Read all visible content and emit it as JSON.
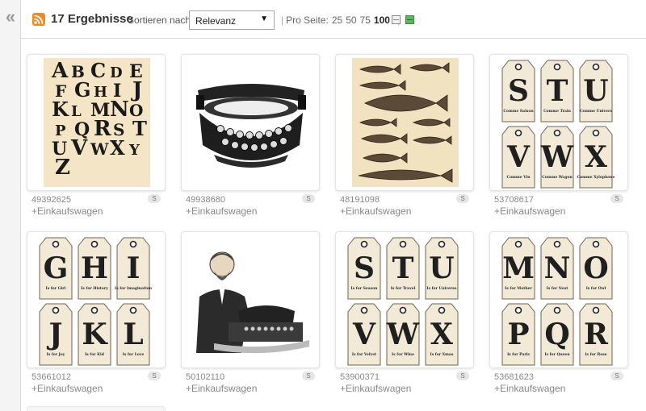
{
  "sidebar": {
    "collapse_glyph": "«",
    "collapse_icon": "double-chevron-left-icon"
  },
  "toolbar": {
    "feed_icon": "rss-icon",
    "result_count": "17 Ergebnisse",
    "sort_label": "Sortieren nach",
    "sort_value": "Relevanz",
    "per_page_label": "Pro Seite:",
    "per_page_options": [
      "25",
      "50",
      "75",
      "100"
    ],
    "per_page_selected": "100",
    "view_grid_icon": "grid-view-icon",
    "view_list_icon": "list-view-icon"
  },
  "colors": {
    "rss": "#f08a24",
    "active_view": "#5cb85c",
    "link": "#888888"
  },
  "results": [
    {
      "id": "49392625",
      "badge": "S",
      "cart": "+Einkaufswagen",
      "subject": "vintage-alphabet-letters"
    },
    {
      "id": "49938680",
      "badge": "S",
      "cart": "+Einkaufswagen",
      "subject": "vintage-typewriter"
    },
    {
      "id": "48191098",
      "badge": "S",
      "cart": "+Einkaufswagen",
      "subject": "vintage-fish-chart"
    },
    {
      "id": "53708617",
      "badge": "S",
      "cart": "+Einkaufswagen",
      "subject": "letter-tags-stuvwx"
    },
    {
      "id": "53661012",
      "badge": "S",
      "cart": "+Einkaufswagen",
      "subject": "letter-tags-ghijkl"
    },
    {
      "id": "50102110",
      "badge": "S",
      "cart": "+Einkaufswagen",
      "subject": "man-with-typewriter"
    },
    {
      "id": "53900371",
      "badge": "S",
      "cart": "+Einkaufswagen",
      "subject": "letter-tags-stuvwx-english"
    },
    {
      "id": "53681623",
      "badge": "S",
      "cart": "+Einkaufswagen",
      "subject": "letter-tags-mnopqr"
    }
  ],
  "tags": {
    "t4": {
      "letters": [
        "S",
        "T",
        "U",
        "V",
        "W",
        "X"
      ],
      "captions": [
        "Comme Saison",
        "Comme Train",
        "Comme Univers",
        "Comme Vin",
        "Comme Wagon",
        "Comme Xylophone"
      ]
    },
    "t5": {
      "letters": [
        "G",
        "H",
        "I",
        "J",
        "K",
        "L"
      ],
      "captions": [
        "Is for Girl",
        "Is for History",
        "Is for Imagination",
        "Is for Joy",
        "Is for Kid",
        "Is for Love"
      ]
    },
    "t7": {
      "letters": [
        "S",
        "T",
        "U",
        "V",
        "W",
        "X"
      ],
      "captions": [
        "Is for Season",
        "Is for Travel",
        "Is for Universe",
        "Is for Velvet",
        "Is for Wine",
        "Is for Xmas"
      ]
    },
    "t8": {
      "letters": [
        "M",
        "N",
        "O",
        "P",
        "Q",
        "R"
      ],
      "captions": [
        "Is for Mother",
        "Is for Nest",
        "Is for Owl",
        "Is for Paris",
        "Is for Queen",
        "Is for Rose"
      ]
    }
  },
  "alphabet_art": [
    "A",
    "B",
    "C",
    "D",
    "E",
    "F",
    "G",
    "H",
    "I",
    "J",
    "K",
    "L",
    "M",
    "N",
    "O",
    "P",
    "Q",
    "R",
    "S",
    "T",
    "U",
    "V",
    "W",
    "X",
    "Y",
    "Z"
  ]
}
